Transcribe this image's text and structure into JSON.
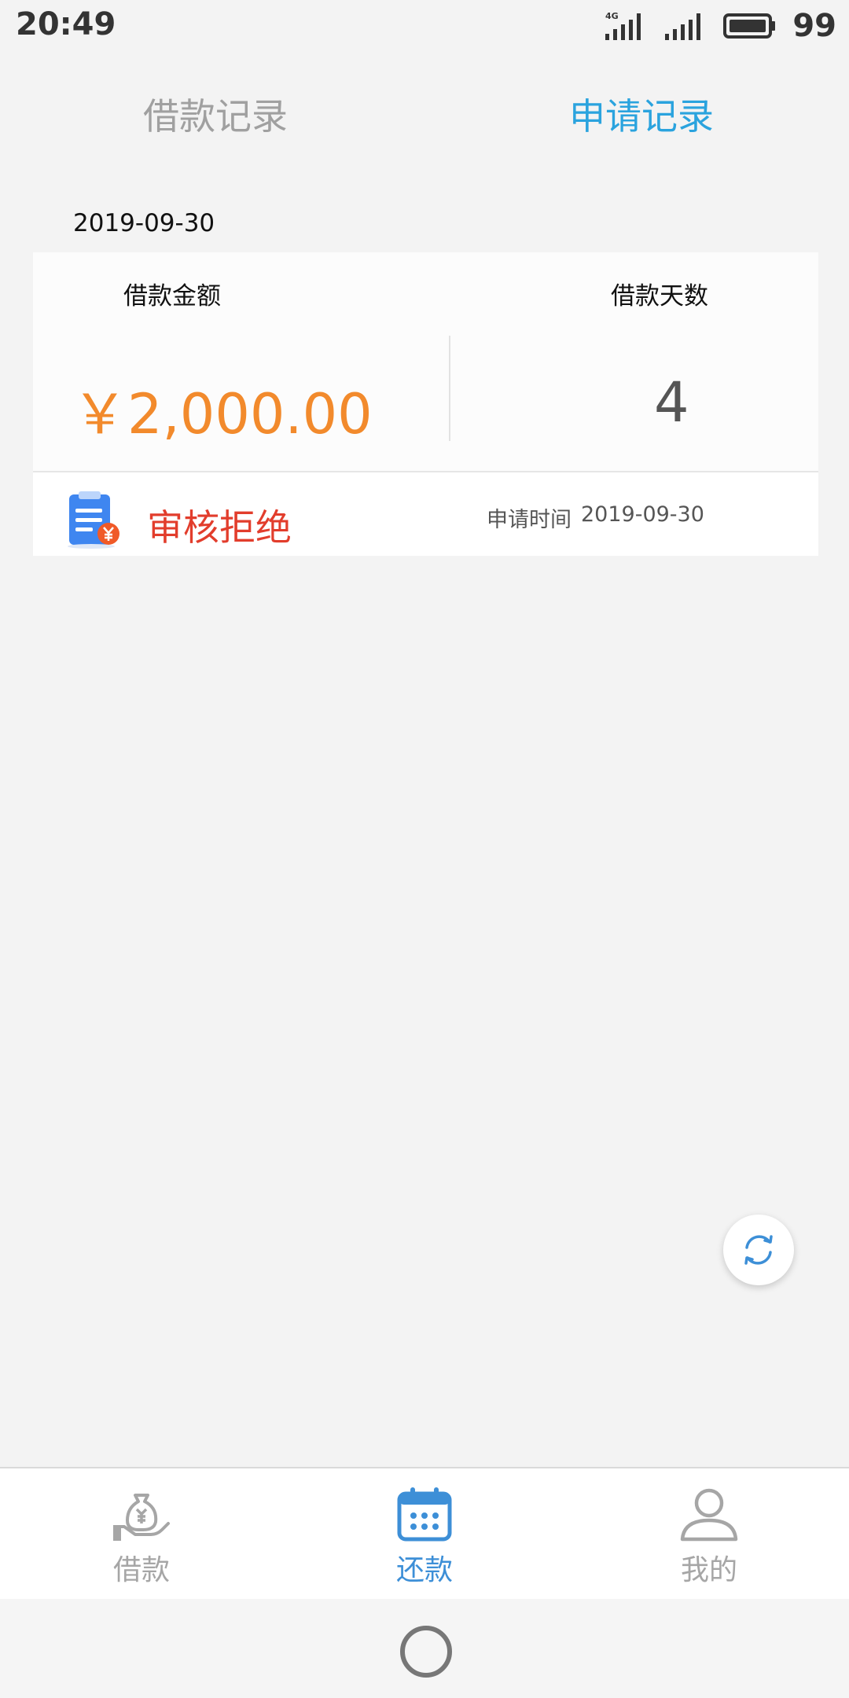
{
  "status_bar": {
    "time": "20:49",
    "network": "4G",
    "battery": "99"
  },
  "tabs": [
    {
      "label": "借款记录",
      "active": false
    },
    {
      "label": "申请记录",
      "active": true
    }
  ],
  "record": {
    "date": "2019-09-30",
    "amount_label": "借款金额",
    "days_label": "借款天数",
    "amount": "￥2,000.00",
    "days": "4",
    "status": "审核拒绝",
    "apply_time_label": "申请时间",
    "apply_time": "2019-09-30"
  },
  "bottom_nav": [
    {
      "label": "借款",
      "active": false
    },
    {
      "label": "还款",
      "active": true
    },
    {
      "label": "我的",
      "active": false
    }
  ],
  "colors": {
    "accent": "#2aa3de",
    "amount": "#f28a2c",
    "rejected": "#e23d2c",
    "nav_active": "#3d8fd7",
    "nav_inactive": "#a6a6a6"
  },
  "icons": {
    "refresh": "refresh-icon",
    "document": "document-yuan-icon",
    "borrow": "money-bag-hand-icon",
    "repay": "calendar-icon",
    "mine": "user-icon"
  }
}
